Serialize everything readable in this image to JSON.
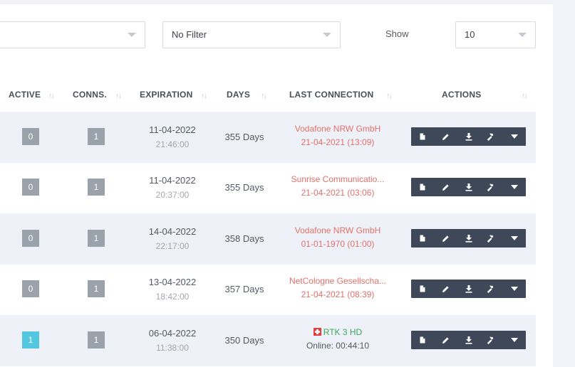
{
  "filters": {
    "first_value": "",
    "second_value": "No Filter",
    "show_label": "Show",
    "show_value": "10"
  },
  "columns": [
    {
      "label": "ACTIVE"
    },
    {
      "label": "CONNS."
    },
    {
      "label": "EXPIRATION"
    },
    {
      "label": "DAYS"
    },
    {
      "label": "LAST CONNECTION"
    },
    {
      "label": "ACTIONS"
    }
  ],
  "sort_glyph": "↑↓",
  "colors": {
    "badge_gray": "#9aa2ab",
    "badge_active": "#54c7e0",
    "connection_red": "#e0706b",
    "connection_green": "#3aa85a",
    "action_bar": "#3e4858"
  },
  "rows": [
    {
      "active": "0",
      "active_state": "inactive",
      "conns": "1",
      "exp_date": "11-04-2022",
      "exp_time": "21:46:00",
      "days": "355 Days",
      "conn_line1": "Vodafone NRW GmbH",
      "conn_line2": "21-04-2021 (13:09)",
      "conn_status": "offline"
    },
    {
      "active": "0",
      "active_state": "inactive",
      "conns": "1",
      "exp_date": "11-04-2022",
      "exp_time": "20:37:00",
      "days": "355 Days",
      "conn_line1": "Sunrise Communicatio...",
      "conn_line2": "21-04-2021 (03:06)",
      "conn_status": "offline"
    },
    {
      "active": "0",
      "active_state": "inactive",
      "conns": "1",
      "exp_date": "14-04-2022",
      "exp_time": "22:17:00",
      "days": "358 Days",
      "conn_line1": "Vodafone NRW GmbH",
      "conn_line2": "01-01-1970 (01:00)",
      "conn_status": "offline"
    },
    {
      "active": "0",
      "active_state": "inactive",
      "conns": "1",
      "exp_date": "13-04-2022",
      "exp_time": "18:42:00",
      "days": "357 Days",
      "conn_line1": "NetCologne Gesellscha...",
      "conn_line2": "21-04-2021 (08:39)",
      "conn_status": "offline"
    },
    {
      "active": "1",
      "active_state": "active",
      "conns": "1",
      "exp_date": "06-04-2022",
      "exp_time": "11:38:00",
      "days": "350 Days",
      "conn_line1": "RTK 3 HD",
      "conn_line2": "Online: 00:44:10",
      "conn_status": "online",
      "conn_flag": "swiss-flag-icon"
    }
  ],
  "action_icons": [
    "file-icon",
    "pencil-icon",
    "download-icon",
    "hammer-icon",
    "caret-down-icon"
  ]
}
